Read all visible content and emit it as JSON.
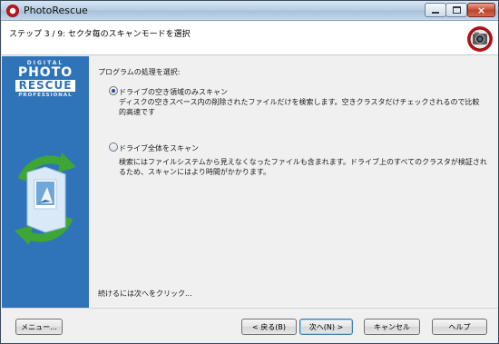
{
  "window": {
    "title": "PhotoRescue",
    "controls": {
      "minimize": "minimize",
      "maximize": "maximize",
      "close": "×"
    }
  },
  "header": {
    "step_title": "ステップ 3 / 9: セクタ毎のスキャンモードを選択"
  },
  "sidebar": {
    "brand_line1": "DIGITAL",
    "brand_line2": "PHOTO",
    "brand_line3": "RESCUE",
    "brand_line4": "PROFESSIONAL"
  },
  "content": {
    "prompt": "プログラムの処理を選択:",
    "options": [
      {
        "label": "ドライブの空き領域のみスキャン",
        "description": "ディスクの空きスペース内の削除されたファイルだけを検索します。空きクラスタだけチェックされるので比較的高速です",
        "selected": true
      },
      {
        "label": "ドライブ全体をスキャン",
        "description": "検索にはファイルシステムから見えなくなったファイルも含まれます。ドライブ上のすべてのクラスタが検証されるため、スキャンにはより時間がかかります。",
        "selected": false
      }
    ],
    "continue_hint": "続けるには次へをクリック..."
  },
  "footer": {
    "menu": "メニュー...",
    "back": "< 戻る(B)",
    "next": "次へ(N) >",
    "cancel": "キャンセル",
    "help": "ヘルプ"
  },
  "colors": {
    "sidebar": "#2f74b8",
    "accent_red": "#c0141b",
    "arrow_green": "#3fa535"
  }
}
